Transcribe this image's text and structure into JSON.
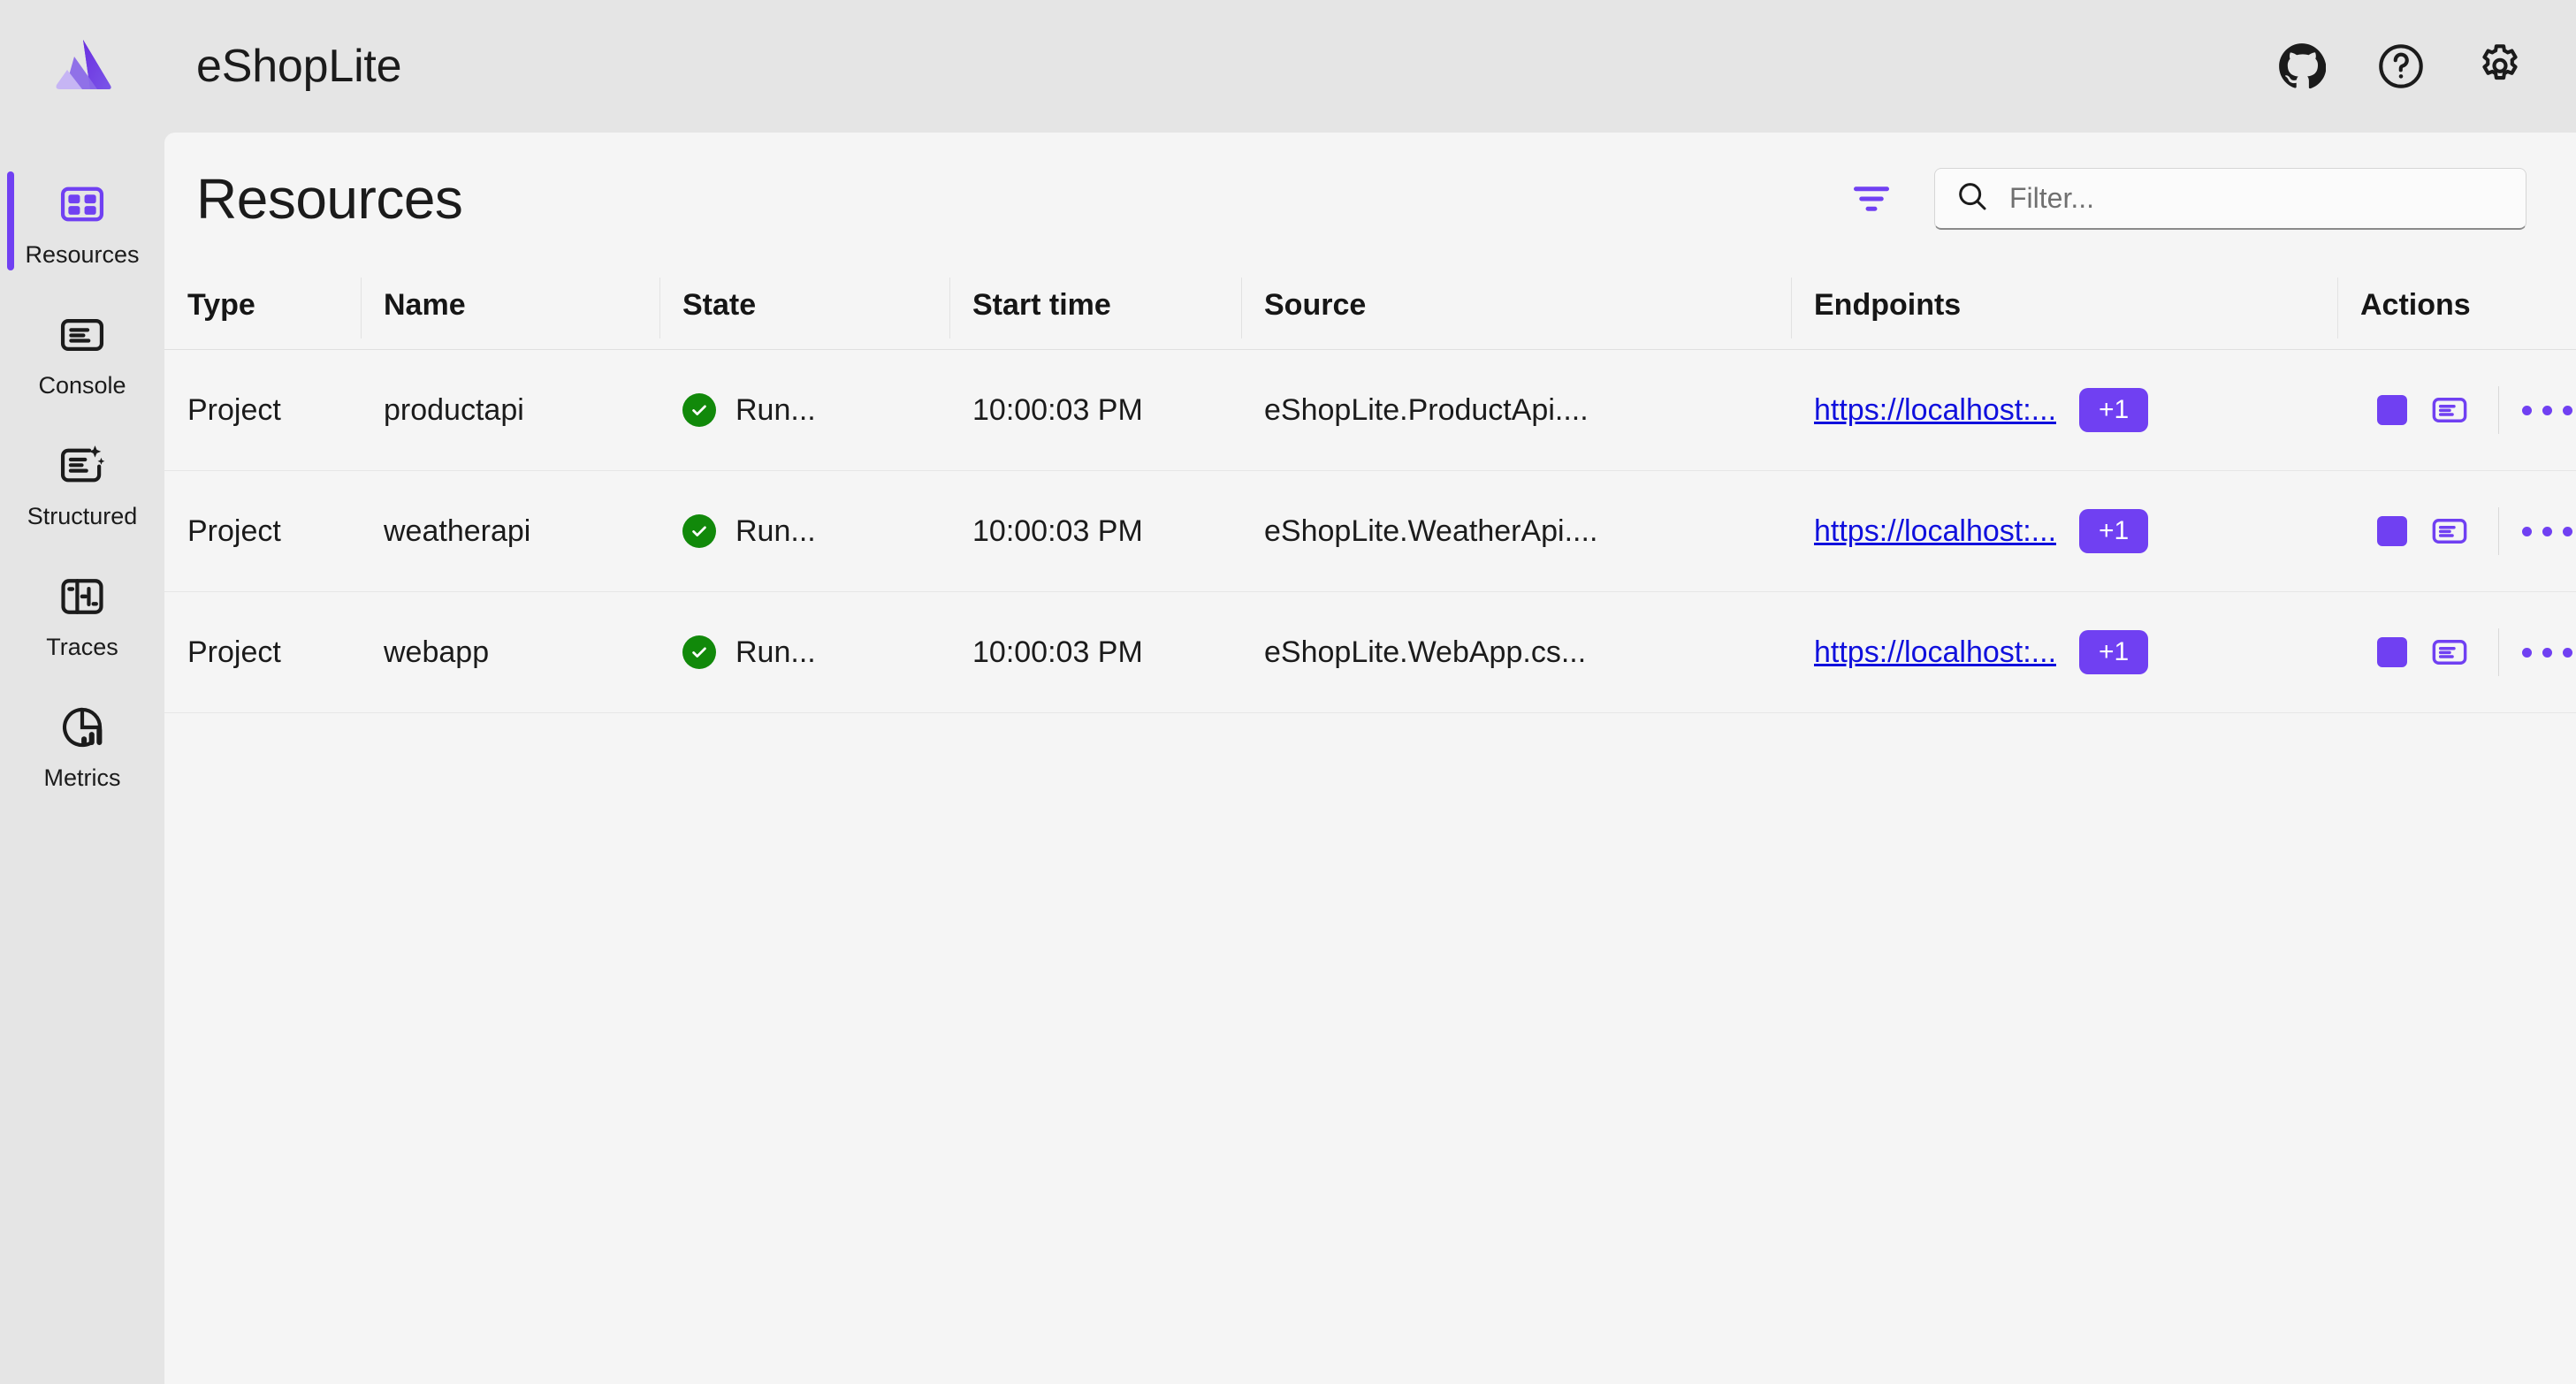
{
  "header": {
    "app_title": "eShopLite",
    "logo_name": "aspire-logo",
    "icons": [
      {
        "name": "github-icon",
        "label": "GitHub"
      },
      {
        "name": "help-icon",
        "label": "Help"
      },
      {
        "name": "settings-gear-icon",
        "label": "Settings"
      }
    ]
  },
  "sidebar": {
    "items": [
      {
        "label": "Resources",
        "icon": "resources-grid-icon",
        "selected": true
      },
      {
        "label": "Console",
        "icon": "console-icon",
        "selected": false
      },
      {
        "label": "Structured",
        "icon": "structured-logs-icon",
        "selected": false
      },
      {
        "label": "Traces",
        "icon": "traces-icon",
        "selected": false
      },
      {
        "label": "Metrics",
        "icon": "metrics-chart-icon",
        "selected": false
      }
    ]
  },
  "page": {
    "title": "Resources",
    "filter_icon_label": "filter-icon",
    "search": {
      "placeholder": "Filter...",
      "value": "",
      "icon": "search-icon"
    }
  },
  "table": {
    "columns": [
      "Type",
      "Name",
      "State",
      "Start time",
      "Source",
      "Endpoints",
      "Actions"
    ],
    "rows": [
      {
        "type": "Project",
        "name": "productapi",
        "state": "Run...",
        "state_color": "#11890a",
        "start_time": "10:00:03 PM",
        "source": "eShopLite.ProductApi....",
        "endpoint": "https://localhost:...",
        "endpoint_badge": "+1"
      },
      {
        "type": "Project",
        "name": "weatherapi",
        "state": "Run...",
        "state_color": "#11890a",
        "start_time": "10:00:03 PM",
        "source": "eShopLite.WeatherApi....",
        "endpoint": "https://localhost:...",
        "endpoint_badge": "+1"
      },
      {
        "type": "Project",
        "name": "webapp",
        "state": "Run...",
        "state_color": "#11890a",
        "start_time": "10:00:03 PM",
        "source": "eShopLite.WebApp.cs...",
        "endpoint": "https://localhost:...",
        "endpoint_badge": "+1"
      }
    ],
    "row_actions": [
      {
        "name": "stop-resource-button",
        "icon": "stop-square-icon"
      },
      {
        "name": "view-console-logs-button",
        "icon": "console-logs-icon"
      },
      {
        "name": "more-actions-button",
        "icon": "ellipsis-horizontal-icon"
      }
    ]
  },
  "colors": {
    "accent": "#7040f2",
    "running": "#11890a",
    "link": "#1010dd",
    "chrome_bg": "#e5e5e5",
    "panel_bg": "#f5f5f5"
  }
}
